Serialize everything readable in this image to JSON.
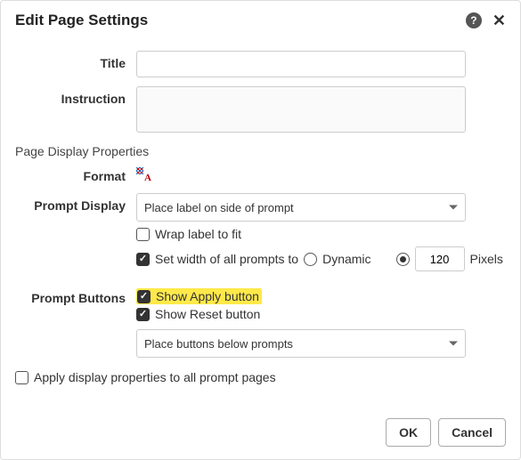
{
  "header": {
    "title": "Edit Page Settings"
  },
  "fields": {
    "title_label": "Title",
    "title_value": "",
    "instruction_label": "Instruction",
    "instruction_value": ""
  },
  "section_heading": "Page Display Properties",
  "format": {
    "label": "Format"
  },
  "prompt_display": {
    "label": "Prompt Display",
    "selected": "Place label on side of prompt",
    "wrap_label": "Wrap label to fit",
    "wrap_checked": false,
    "set_width_label": "Set width of all prompts to",
    "set_width_checked": true,
    "dynamic_label": "Dynamic",
    "dynamic_selected": false,
    "pixels_selected": true,
    "pixels_value": "120",
    "pixels_unit": "Pixels"
  },
  "prompt_buttons": {
    "label": "Prompt Buttons",
    "show_apply_label": "Show Apply button",
    "show_apply_checked": true,
    "show_reset_label": "Show Reset button",
    "show_reset_checked": true,
    "placement_selected": "Place buttons below prompts"
  },
  "apply_all": {
    "label": "Apply display properties to all prompt pages",
    "checked": false
  },
  "footer": {
    "ok": "OK",
    "cancel": "Cancel"
  }
}
